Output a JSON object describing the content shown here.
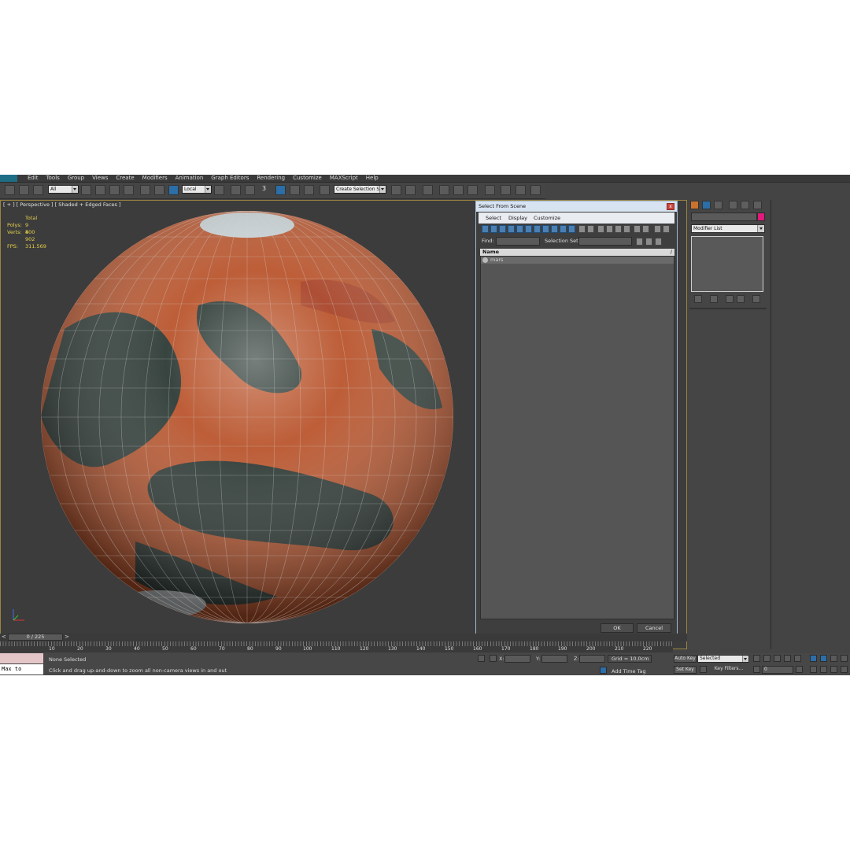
{
  "menu": [
    "Edit",
    "Tools",
    "Group",
    "Views",
    "Create",
    "Modifiers",
    "Animation",
    "Graph Editors",
    "Rendering",
    "Customize",
    "MAXScript",
    "Help"
  ],
  "toolbar": {
    "selection_filter": "All",
    "ref_coord": "Local",
    "snap_label": "3",
    "named_selection": "Create Selection Se"
  },
  "viewport": {
    "label": "[ + ] [ Perspective ] [ Shaded + Edged Faces ]",
    "stats": {
      "header": "Total",
      "polys_label": "Polys:",
      "polys_value": "9 800",
      "verts_label": "Verts:",
      "verts_value": "4 902",
      "fps_label": "FPS:",
      "fps_value": "311.569"
    }
  },
  "dialog": {
    "title": "Select From Scene",
    "close": "x",
    "menu": [
      "Select",
      "Display",
      "Customize"
    ],
    "find_label": "Find:",
    "selset_label": "Selection Set:",
    "column_name": "Name",
    "sort_indicator": "/",
    "items": [
      "mars"
    ],
    "ok_label": "OK",
    "cancel_label": "Cancel"
  },
  "command_panel": {
    "modifier_list": "Modifier List",
    "object_color": "#e21a7c"
  },
  "timeline": {
    "frame_display": "0 / 225",
    "prev": "<",
    "next": ">",
    "ticks": [
      "10",
      "20",
      "30",
      "40",
      "50",
      "60",
      "70",
      "80",
      "90",
      "100",
      "110",
      "120",
      "130",
      "140",
      "150",
      "160",
      "170",
      "180",
      "190",
      "200",
      "210",
      "220"
    ]
  },
  "status": {
    "maxscript_text": "Max to Physc.",
    "selection_text": "None Selected",
    "prompt_text": "Click and drag up-and-down to zoom all non-camera views in and out",
    "x_label": "X:",
    "y_label": "Y:",
    "z_label": "Z:",
    "grid_text": "Grid = 10,0cm",
    "add_time_tag": "Add Time Tag",
    "auto_key": "Auto Key",
    "set_key": "Set Key",
    "selected": "Selected",
    "key_filters": "Key Filters...",
    "current_frame": "0"
  }
}
